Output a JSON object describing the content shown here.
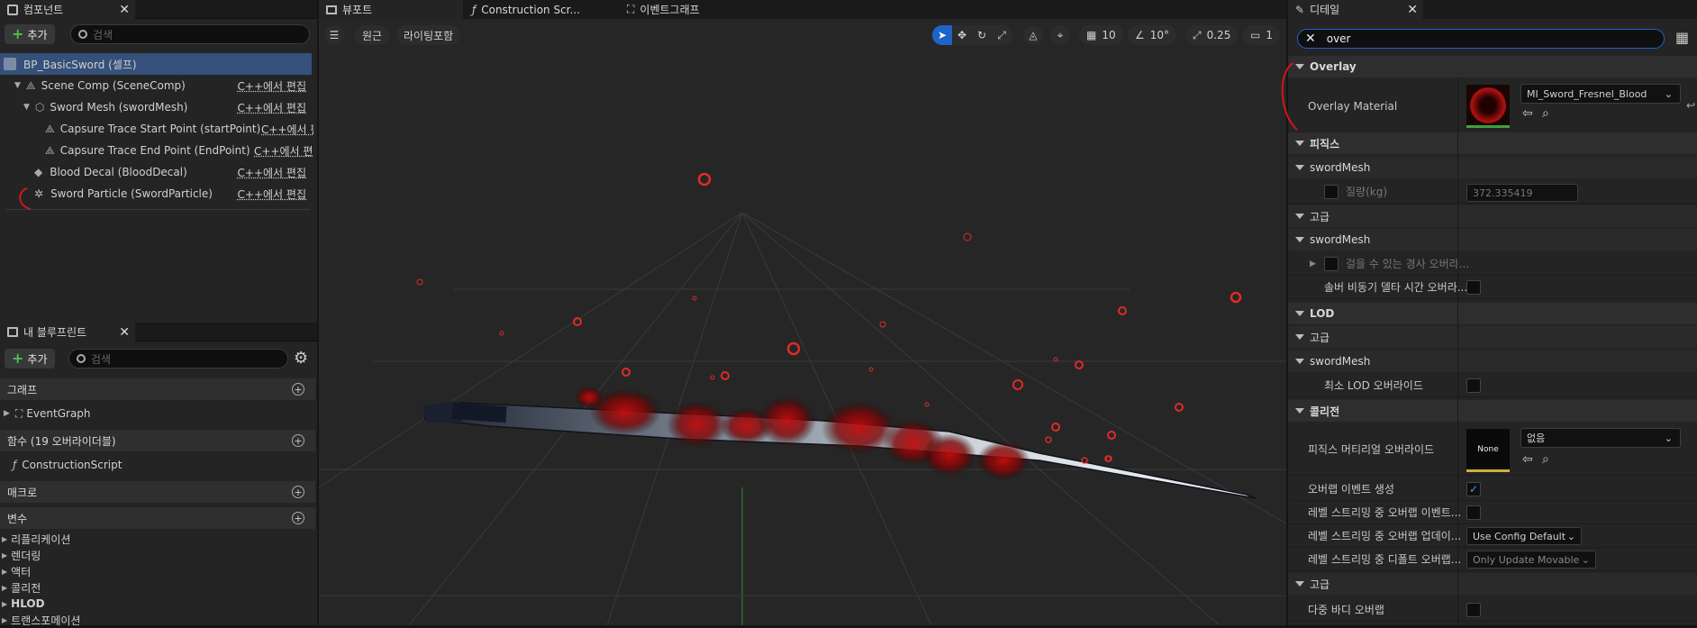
{
  "components": {
    "tab_label": "컴포넌트",
    "add_label": "추가",
    "search_placeholder": "검색",
    "root_label": "BP_BasicSword (셀프)",
    "items": [
      {
        "label": "Scene Comp (SceneComp)",
        "edit": "C++에서 편집"
      },
      {
        "label": "Sword Mesh (swordMesh)",
        "edit": "C++에서 편집"
      },
      {
        "label": "Capsure Trace Start Point (startPoint)",
        "edit": "C++에서 편"
      },
      {
        "label": "Capsure Trace End Point (EndPoint)",
        "edit": "C++에서 편집"
      },
      {
        "label": "Blood Decal (BloodDecal)",
        "edit": "C++에서 편집"
      },
      {
        "label": "Sword Particle (SwordParticle)",
        "edit": "C++에서 편집"
      }
    ]
  },
  "my_blueprint": {
    "tab_label": "내 블루프린트",
    "add_label": "추가",
    "search_placeholder": "검색",
    "graph_label": "그래프",
    "event_graph": "EventGraph",
    "functions_label": "함수 (19 오버라이더블)",
    "construction_script": "ConstructionScript",
    "macros_label": "매크로",
    "variables_label": "변수",
    "var_categories": [
      "리플리케이션",
      "렌더링",
      "액터",
      "콜리전",
      "HLOD",
      "트랜스포메이션"
    ]
  },
  "viewport": {
    "tab_label": "뷰포트",
    "construction_tab": "Construction Scr...",
    "event_graph_tab": "이벤트그래프",
    "perspective_label": "원근",
    "lighting_label": "라이팅포함",
    "grid_snap": "10",
    "rotation_snap": "10°",
    "scale_snap": "0.25",
    "camera_speed": "1"
  },
  "details": {
    "tab_label": "디테일",
    "search_value": "over",
    "sections": {
      "overlay": "Overlay",
      "overlay_material_label": "Overlay Material",
      "overlay_material_value": "MI_Sword_Fresnel_Blood",
      "physics": "피직스",
      "sword_mesh_1": "swordMesh",
      "mass_label": "질량(kg)",
      "mass_value": "372.335419",
      "advanced_1": "고급",
      "sword_mesh_2": "swordMesh",
      "walkable_slope": "걸을 수 있는 경사 오버라...",
      "substep_delta": "솔버 비동기 델타 시간 오버라...",
      "lod": "LOD",
      "advanced_2": "고급",
      "sword_mesh_3": "swordMesh",
      "min_lod": "최소 LOD 오버라이드",
      "collision": "콜리전",
      "phys_material_override": "피직스 머티리얼 오버라이드",
      "phys_material_thumb": "None",
      "phys_material_value": "없음",
      "generate_overlap": "오버랩 이벤트 생성",
      "level_streaming_overlap": "레벨 스트리밍 중 오버랩 이벤트...",
      "level_streaming_update": "레벨 스트리밍 중 오버랩 업데이...",
      "update_method_value": "Use Config Default",
      "level_streaming_default": "레벨 스트리밍 중 디폴트 오버랩...",
      "default_update_value": "Only Update Movable",
      "advanced_3": "고급",
      "multi_body_overlap": "다중 바디 오버랩"
    }
  },
  "colors": {
    "accent_blue": "#1e64c8",
    "annotation_red": "#d01818",
    "particle_red": "#e02a2a"
  }
}
